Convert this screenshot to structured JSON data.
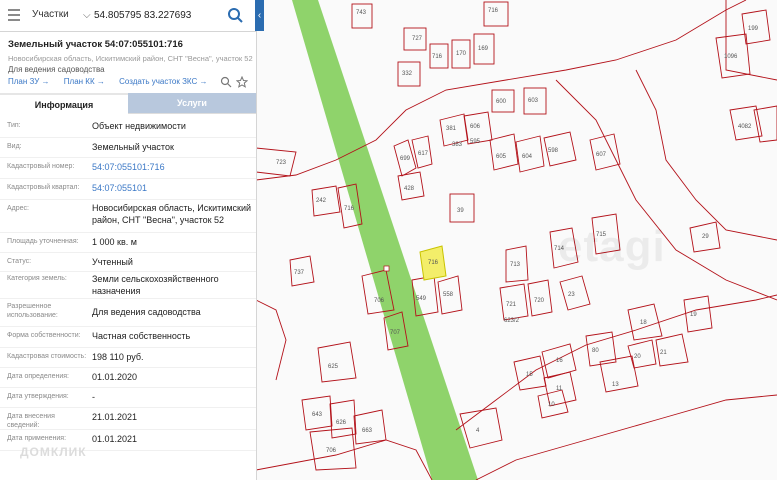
{
  "search": {
    "layer": "Участки",
    "query": "54.805795 83.227693"
  },
  "parcel": {
    "title": "Земельный участок 54:07:055101:716",
    "address": "Новосибирская область, Искитимский район, СНТ \"Весна\", участок 52",
    "purpose": "Для ведения садоводства"
  },
  "links": [
    "План ЗУ →",
    "План КК →",
    "Создать участок ЗКС →"
  ],
  "tabs": [
    "Информация",
    "Услуги"
  ],
  "rows": [
    {
      "label": "Тип:",
      "value": "Объект недвижимости"
    },
    {
      "label": "Вид:",
      "value": "Земельный участок"
    },
    {
      "label": "Кадастровый номер:",
      "value": "54:07:055101:716",
      "link": true
    },
    {
      "label": "Кадастровый квартал:",
      "value": "54:07:055101",
      "link": true
    },
    {
      "label": "Адрес:",
      "value": "Новосибирская область, Искитимский район, СНТ \"Весна\", участок 52"
    },
    {
      "label": "Площадь уточненная:",
      "value": "1 000 кв. м"
    },
    {
      "label": "Статус:",
      "value": "Учтенный"
    },
    {
      "label": "Категория земель:",
      "value": "Земли сельскохозяйственного назначения"
    },
    {
      "label": "Разрешенное использование:",
      "value": "Для ведения садоводства"
    },
    {
      "label": "Форма собственности:",
      "value": "Частная собственность"
    },
    {
      "label": "Кадастровая стоимость:",
      "value": "198 110 руб."
    },
    {
      "label": "Дата определения:",
      "value": "01.01.2020"
    },
    {
      "label": "Дата утверждения:",
      "value": "-"
    },
    {
      "label": "Дата внесения сведений:",
      "value": "21.01.2021"
    },
    {
      "label": "Дата применения:",
      "value": "01.01.2021"
    }
  ],
  "map": {
    "plot_labels": [
      "743",
      "727",
      "716",
      "170",
      "169",
      "171",
      "174",
      "381",
      "382",
      "383",
      "606",
      "600",
      "603",
      "607",
      "615",
      "617",
      "691",
      "428",
      "39",
      "723",
      "242",
      "716",
      "708",
      "737",
      "713",
      "714",
      "718",
      "715",
      "711",
      "721",
      "720",
      "623/2",
      "18",
      "17",
      "16",
      "15",
      "14",
      "13",
      "10",
      "11",
      "20",
      "21",
      "29",
      "199",
      "4082",
      "625",
      "643",
      "626",
      "663",
      "706",
      "4",
      "3",
      "724",
      "720"
    ]
  },
  "watermarks": {
    "etagi": "etagi",
    "domclick": "ДОМКЛИК"
  },
  "colors": {
    "accent": "#2b6cb0",
    "link": "#3b78c6",
    "road": "#8fd36b",
    "highlight": "#f3ee6a",
    "boundary": "#b3121a"
  }
}
